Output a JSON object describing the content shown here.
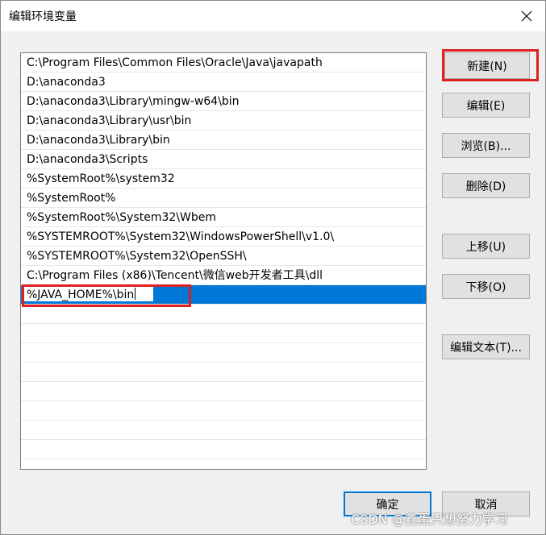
{
  "window": {
    "title": "编辑环境变量"
  },
  "paths": [
    "C:\\Program Files\\Common Files\\Oracle\\Java\\javapath",
    "D:\\anaconda3",
    "D:\\anaconda3\\Library\\mingw-w64\\bin",
    "D:\\anaconda3\\Library\\usr\\bin",
    "D:\\anaconda3\\Library\\bin",
    "D:\\anaconda3\\Scripts",
    "%SystemRoot%\\system32",
    "%SystemRoot%",
    "%SystemRoot%\\System32\\Wbem",
    "%SYSTEMROOT%\\System32\\WindowsPowerShell\\v1.0\\",
    "%SYSTEMROOT%\\System32\\OpenSSH\\",
    "C:\\Program Files (x86)\\Tencent\\微信web开发者工具\\dll"
  ],
  "editing_value": "%JAVA_HOME%\\bin",
  "buttons": {
    "new": "新建(N)",
    "edit": "编辑(E)",
    "browse": "浏览(B)...",
    "delete": "删除(D)",
    "move_up": "上移(U)",
    "move_down": "下移(O)",
    "edit_text": "编辑文本(T)...",
    "ok": "确定",
    "cancel": "取消"
  },
  "watermark": "CSDN @鑫蛋只想努力学习",
  "colors": {
    "selection": "#0078d7",
    "highlight": "#e02020"
  }
}
